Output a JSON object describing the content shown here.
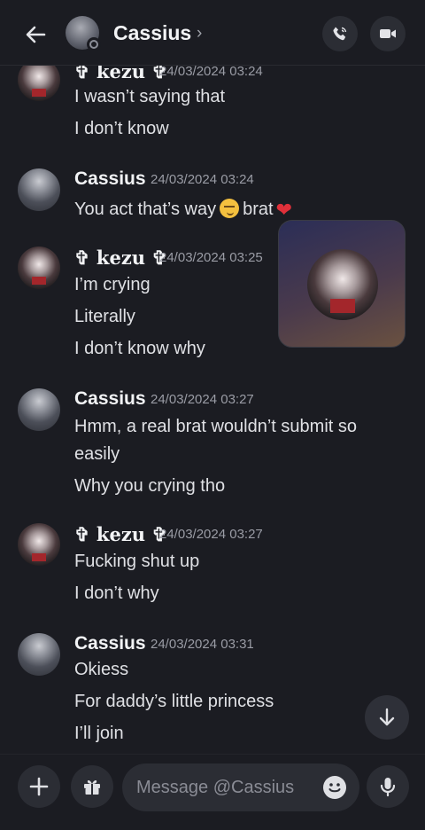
{
  "header": {
    "name": "Cassius",
    "chevron": "›",
    "icons": [
      "back-arrow-icon",
      "phone-icon",
      "video-camera-icon"
    ]
  },
  "messages": [
    {
      "author": "✞ kezu ✞",
      "timestamp": "24/03/2024 03:24",
      "lines": [
        "I wasn’t saying that",
        "I don’t know"
      ]
    },
    {
      "author": "Cassius",
      "timestamp": "24/03/2024 03:24",
      "lines": [
        "You act that’s way",
        "brat"
      ]
    },
    {
      "author": "✞ kezu ✞",
      "timestamp": "24/03/2024 03:25",
      "lines": [
        "I’m crying",
        "Literally",
        "I don’t know why"
      ]
    },
    {
      "author": "Cassius",
      "timestamp": "24/03/2024 03:27",
      "lines": [
        "Hmm, a real brat wouldn’t submit so",
        "easily",
        "Why you crying tho"
      ]
    },
    {
      "author": "✞ kezu ✞",
      "timestamp": "24/03/2024 03:27",
      "lines": [
        "Fucking shut up",
        "I don’t why"
      ]
    },
    {
      "author": "Cassius",
      "timestamp": "24/03/2024 03:31",
      "lines": [
        "Okiess",
        "For daddy’s little princess",
        "I’ll join"
      ]
    }
  ],
  "composer": {
    "placeholder": "Message @Cassius",
    "icons": [
      "plus-icon",
      "gift-icon",
      "emoji-icon",
      "microphone-icon"
    ]
  },
  "colors": {
    "background": "#1b1c22",
    "surface": "#2b2d34",
    "text": "#dfe0e4",
    "muted": "#9a9ca5"
  }
}
